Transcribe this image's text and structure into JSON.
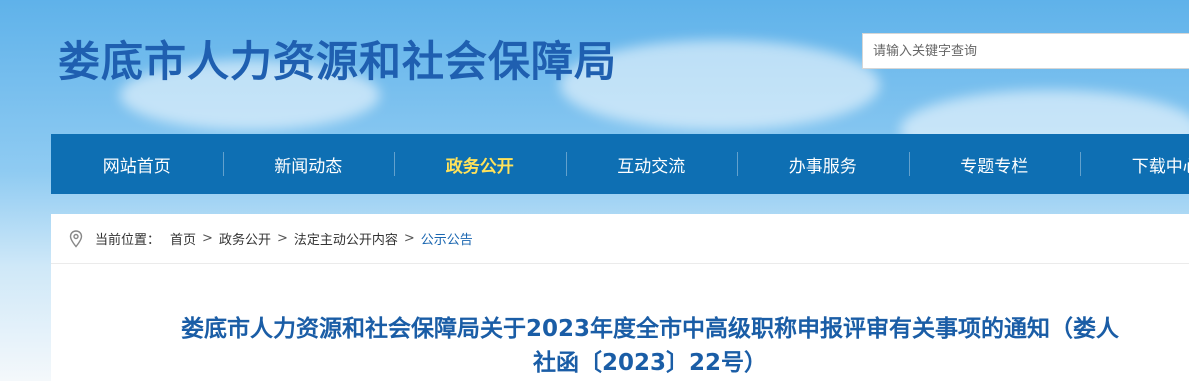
{
  "site": {
    "title": "娄底市人力资源和社会保障局",
    "search_placeholder": "请输入关键字查询"
  },
  "nav": {
    "items": [
      {
        "label": "网站首页",
        "active": false
      },
      {
        "label": "新闻动态",
        "active": false
      },
      {
        "label": "政务公开",
        "active": true
      },
      {
        "label": "互动交流",
        "active": false
      },
      {
        "label": "办事服务",
        "active": false
      },
      {
        "label": "专题专栏",
        "active": false
      },
      {
        "label": "下载中心",
        "active": false
      }
    ]
  },
  "breadcrumb": {
    "label": "当前位置：",
    "items": [
      "首页",
      "政务公开",
      "法定主动公开内容",
      "公示公告"
    ],
    "separator": ">"
  },
  "article": {
    "title_line1": "娄底市人力资源和社会保障局关于2023年度全市中高级职称申报评审有关事项的通知（娄人",
    "title_line2": "社函〔2023〕22号）"
  },
  "colors": {
    "nav_bg": "#0e6fb3",
    "nav_active": "#ffe25a",
    "title_blue": "#1f5fb0",
    "link_blue": "#1a66b0"
  },
  "icons": {
    "breadcrumb": "location-pin-icon"
  }
}
